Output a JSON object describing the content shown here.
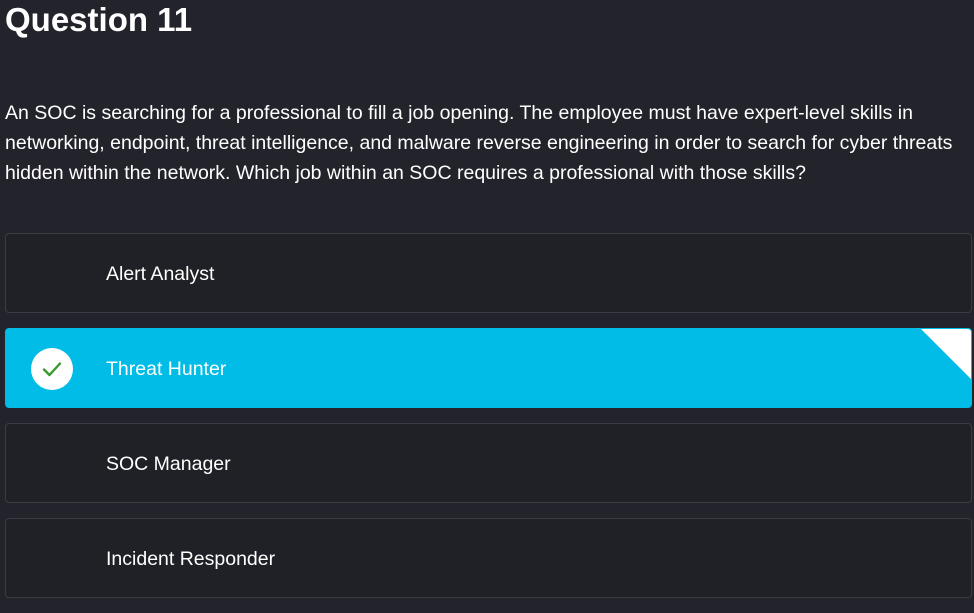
{
  "question": {
    "title": "Question 11",
    "text": "An SOC is searching for a professional to fill a job opening. The employee must have expert-level skills in networking, endpoint, threat intelligence, and malware reverse engineering in order to search for cyber threats hidden within the network. Which job within an SOC requires a professional with those skills?"
  },
  "options": [
    {
      "label": "Alert Analyst",
      "selected": false
    },
    {
      "label": "Threat Hunter",
      "selected": true,
      "icon": "check-icon"
    },
    {
      "label": "SOC Manager",
      "selected": false
    },
    {
      "label": "Incident Responder",
      "selected": false
    }
  ],
  "colors": {
    "background": "#23242b",
    "option_background": "#202126",
    "selected_accent": "#00bce6",
    "check_color": "#3a9a2e"
  }
}
